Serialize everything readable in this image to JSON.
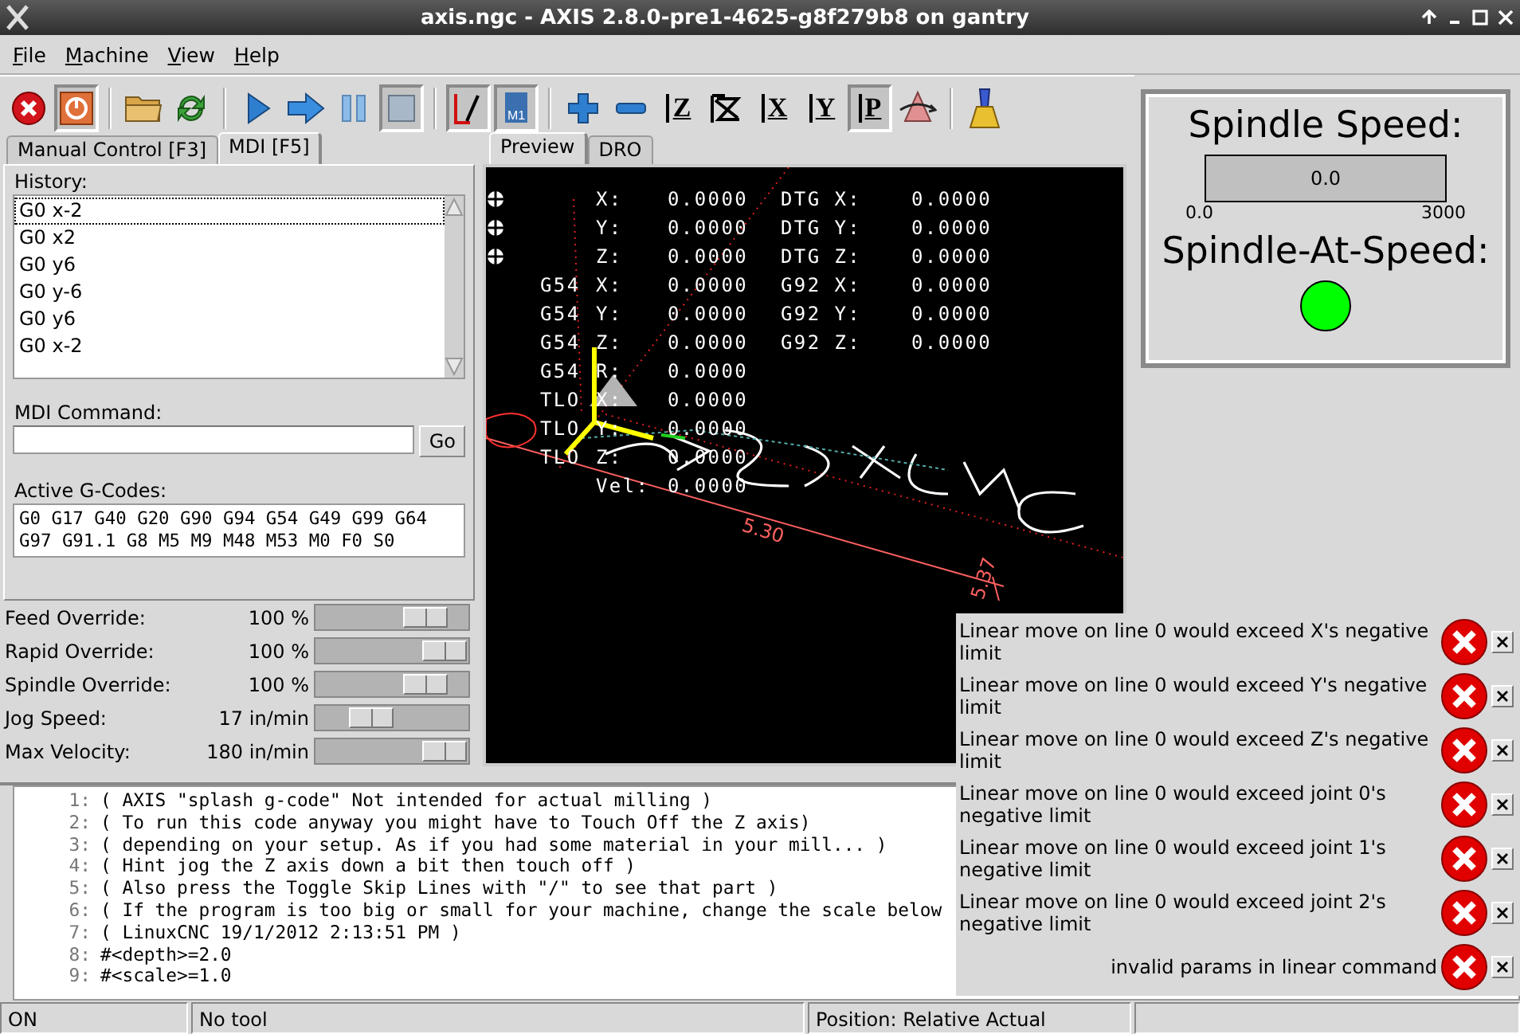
{
  "window": {
    "title": "axis.ngc - AXIS 2.8.0-pre1-4625-g8f279b8 on gantry"
  },
  "menu": [
    {
      "label": "File"
    },
    {
      "label": "Machine"
    },
    {
      "label": "View"
    },
    {
      "label": "Help"
    }
  ],
  "toolbar": [
    {
      "kind": "estop",
      "pressed": false
    },
    {
      "kind": "power",
      "pressed": true
    },
    {
      "kind": "separator"
    },
    {
      "kind": "open",
      "pressed": false
    },
    {
      "kind": "reload",
      "pressed": false
    },
    {
      "kind": "separator"
    },
    {
      "kind": "run",
      "pressed": false
    },
    {
      "kind": "step",
      "pressed": false
    },
    {
      "kind": "pause",
      "pressed": false
    },
    {
      "kind": "stop",
      "pressed": true
    },
    {
      "kind": "separator"
    },
    {
      "kind": "skip",
      "pressed": true
    },
    {
      "kind": "optional-stop",
      "pressed": true,
      "label": "M1"
    },
    {
      "kind": "separator"
    },
    {
      "kind": "zoom-in",
      "pressed": false
    },
    {
      "kind": "zoom-out",
      "pressed": false
    },
    {
      "kind": "view",
      "pressed": false,
      "label": "Z"
    },
    {
      "kind": "view-rotated",
      "pressed": false
    },
    {
      "kind": "view",
      "pressed": false,
      "label": "X"
    },
    {
      "kind": "view",
      "pressed": false,
      "label": "Y"
    },
    {
      "kind": "view",
      "pressed": true,
      "label": "P"
    },
    {
      "kind": "rotate",
      "pressed": false
    },
    {
      "kind": "separator"
    },
    {
      "kind": "clear",
      "pressed": false
    }
  ],
  "left_tabs": [
    {
      "label": "Manual Control [F3]",
      "selected": false
    },
    {
      "label": "MDI [F5]",
      "selected": true
    }
  ],
  "mdi": {
    "history_label": "History:",
    "history": [
      {
        "text": "G0 x-2",
        "selected": true
      },
      {
        "text": "G0 x2",
        "selected": false
      },
      {
        "text": "G0 y6",
        "selected": false
      },
      {
        "text": "G0 y-6",
        "selected": false
      },
      {
        "text": "G0 y6",
        "selected": false
      },
      {
        "text": "G0 x-2",
        "selected": false
      }
    ],
    "command_label": "MDI Command:",
    "go_button": "Go",
    "gcodes_label": "Active G-Codes:",
    "gcodes": [
      "G0 G17 G40 G20 G90 G94 G54 G49 G99 G64",
      "G97 G91.1 G8 M5 M9 M48 M53 M0 F0 S0"
    ]
  },
  "sliders": [
    {
      "label": "Feed Override:",
      "reading": "100 %",
      "level": 0.82
    },
    {
      "label": "Rapid Override:",
      "reading": "100 %",
      "level": 1
    },
    {
      "label": "Spindle Override:",
      "reading": "100 %",
      "level": 0.82
    },
    {
      "label": "Jog Speed:",
      "reading": "17 in/min",
      "level": 0.3
    },
    {
      "label": "Max Velocity:",
      "reading": "180 in/min",
      "level": 1
    }
  ],
  "preview_tabs": [
    {
      "label": "Preview",
      "selected": true
    },
    {
      "label": "DRO",
      "selected": false
    }
  ],
  "dro": [
    {
      "axis": "X:",
      "value": "0.0000",
      "dtg_label": "DTG X:",
      "dtg_value": "0.0000",
      "homed": true
    },
    {
      "axis": "Y:",
      "value": "0.0000",
      "dtg_label": "DTG Y:",
      "dtg_value": "0.0000",
      "homed": true
    },
    {
      "axis": "Z:",
      "value": "0.0000",
      "dtg_label": "DTG Z:",
      "dtg_value": "0.0000",
      "homed": true
    },
    {
      "prefix": "G54",
      "axis": "X:",
      "value": "0.0000",
      "dtg_label": "G92 X:",
      "dtg_value": "0.0000",
      "homed": false
    },
    {
      "prefix": "G54",
      "axis": "Y:",
      "value": "0.0000",
      "dtg_label": "G92 Y:",
      "dtg_value": "0.0000",
      "homed": false
    },
    {
      "prefix": "G54",
      "axis": "Z:",
      "value": "0.0000",
      "dtg_label": "G92 Z:",
      "dtg_value": "0.0000",
      "homed": false
    },
    {
      "prefix": "G54",
      "axis": "R:",
      "value": "0.0000",
      "homed": false
    },
    {
      "prefix": "TLO",
      "axis": "X:",
      "value": "0.0000",
      "homed": false
    },
    {
      "prefix": "TLO",
      "axis": "Y:",
      "value": "0.0000",
      "homed": false
    },
    {
      "prefix": "TLO",
      "axis": "Z:",
      "value": "0.0000",
      "homed": false
    },
    {
      "axis": "Vel:",
      "value": "0.0000",
      "homed": false
    }
  ],
  "preview_scale_labels": [
    "5.30",
    "5.37"
  ],
  "spindle_panel": {
    "speed_title": "Spindle Speed:",
    "bar": {
      "reading": "0.0",
      "level": 0,
      "min": "0.0",
      "max": "3000"
    },
    "at_speed_title": "Spindle-At-Speed:",
    "led": {
      "color": "#00ff00"
    }
  },
  "code": [
    {
      "number": "1:",
      "text": "( AXIS \"splash g-code\" Not intended for actual milling )"
    },
    {
      "number": "2:",
      "text": "( To run this code anyway you might have to Touch Off the Z axis)"
    },
    {
      "number": "3:",
      "text": "( depending on your setup. As if you had some material in your mill... )"
    },
    {
      "number": "4:",
      "text": "( Hint jog the Z axis down a bit then touch off )"
    },
    {
      "number": "5:",
      "text": "( Also press the Toggle Skip Lines with \"/\" to see that part )"
    },
    {
      "number": "6:",
      "text": "( If the program is too big or small for your machine, change the scale below"
    },
    {
      "number": "7:",
      "text": "( LinuxCNC 19/1/2012 2:13:51 PM )"
    },
    {
      "number": "8:",
      "text": "#<depth>=2.0"
    },
    {
      "number": "9:",
      "text": "#<scale>=1.0"
    }
  ],
  "errors": [
    {
      "text": "Linear move on line 0 would exceed X's negative limit"
    },
    {
      "text": "Linear move on line 0 would exceed Y's negative limit"
    },
    {
      "text": "Linear move on line 0 would exceed Z's negative limit"
    },
    {
      "text": "Linear move on line 0 would exceed joint 0's negative limit"
    },
    {
      "text": "Linear move on line 0 would exceed joint 1's negative limit"
    },
    {
      "text": "Linear move on line 0 would exceed joint 2's negative limit"
    },
    {
      "text": "invalid params in linear command"
    }
  ],
  "status_bar": [
    "ON",
    "No tool",
    "Position: Relative Actual"
  ]
}
